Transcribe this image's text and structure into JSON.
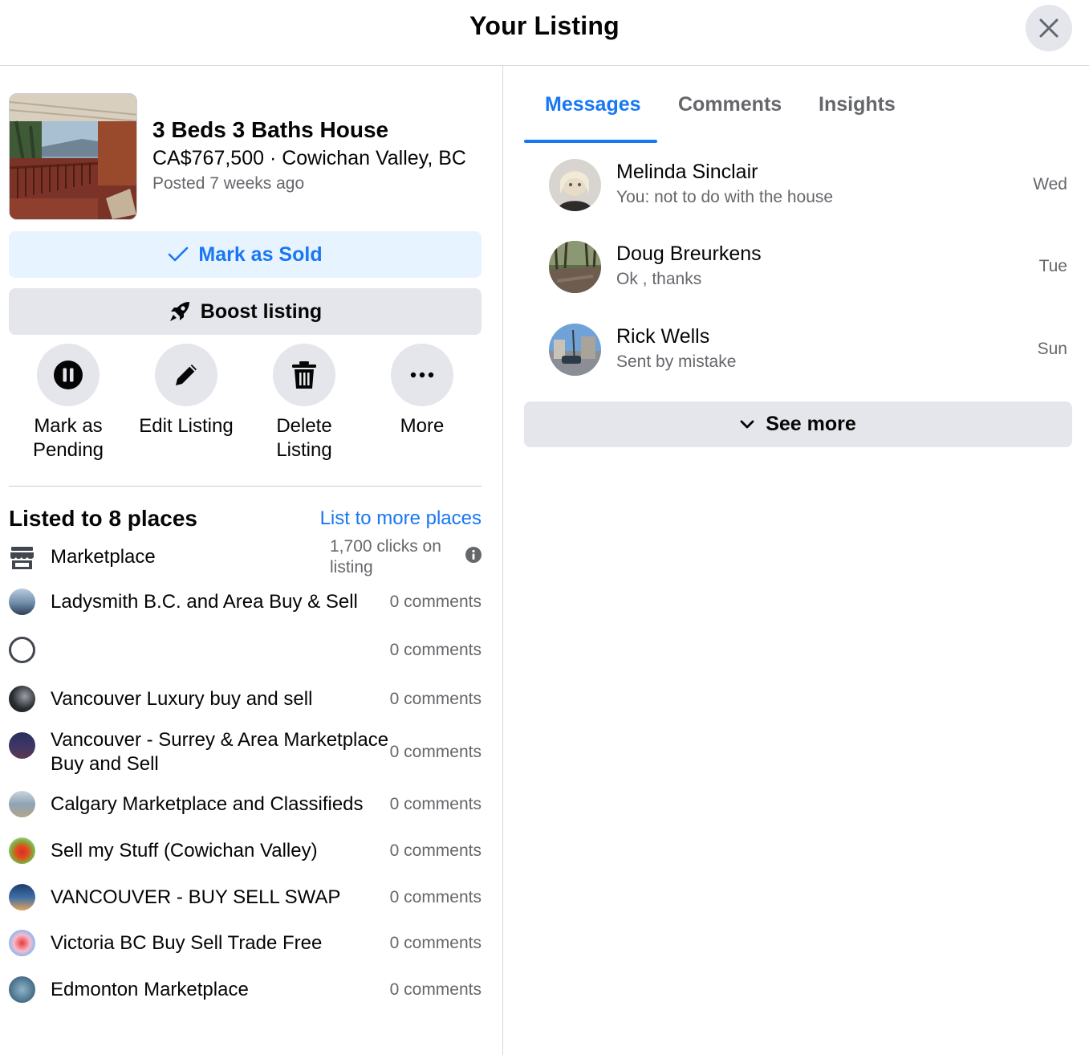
{
  "header": {
    "title": "Your Listing"
  },
  "listing": {
    "title": "3 Beds 3 Baths House",
    "price_location": "CA$767,500 · Cowichan Valley, BC",
    "posted": "Posted 7 weeks ago"
  },
  "buttons": {
    "mark_sold": "Mark as Sold",
    "boost": "Boost listing"
  },
  "actions": [
    {
      "label": "Mark as Pending",
      "icon": "pause-icon"
    },
    {
      "label": "Edit Listing",
      "icon": "pencil-icon"
    },
    {
      "label": "Delete Listing",
      "icon": "trash-icon"
    },
    {
      "label": "More",
      "icon": "more-dots-icon"
    }
  ],
  "places": {
    "heading": "Listed to 8 places",
    "list_more": "List to more places",
    "items": [
      {
        "name": "Marketplace",
        "stat": "1,700 clicks on listing"
      },
      {
        "name": "Ladysmith B.C. and Area Buy & Sell",
        "stat": "0 comments"
      },
      {
        "name": "",
        "stat": "0 comments"
      },
      {
        "name": "Vancouver Luxury buy and sell",
        "stat": "0 comments"
      },
      {
        "name": "Vancouver - Surrey & Area Marketplace Buy and Sell",
        "stat": "0 comments"
      },
      {
        "name": "Calgary Marketplace and Classifieds",
        "stat": "0 comments"
      },
      {
        "name": "Sell my Stuff (Cowichan Valley)",
        "stat": "0 comments"
      },
      {
        "name": "VANCOUVER - BUY SELL SWAP",
        "stat": "0 comments"
      },
      {
        "name": "Victoria BC Buy Sell Trade Free",
        "stat": "0 comments"
      },
      {
        "name": "Edmonton Marketplace",
        "stat": "0 comments"
      }
    ]
  },
  "tabs": [
    {
      "label": "Messages",
      "active": true
    },
    {
      "label": "Comments",
      "active": false
    },
    {
      "label": "Insights",
      "active": false
    }
  ],
  "messages": [
    {
      "name": "Melinda Sinclair",
      "preview": "You: not to do with the house",
      "time": "Wed"
    },
    {
      "name": "Doug Breurkens",
      "preview": "Ok , thanks",
      "time": "Tue"
    },
    {
      "name": "Rick Wells",
      "preview": "Sent by mistake",
      "time": "Sun"
    }
  ],
  "see_more": "See more",
  "colors": {
    "accent": "#1877f2",
    "secondary_bg": "#e4e6eb",
    "sold_bg": "#e7f3ff",
    "muted_text": "#65676b"
  }
}
